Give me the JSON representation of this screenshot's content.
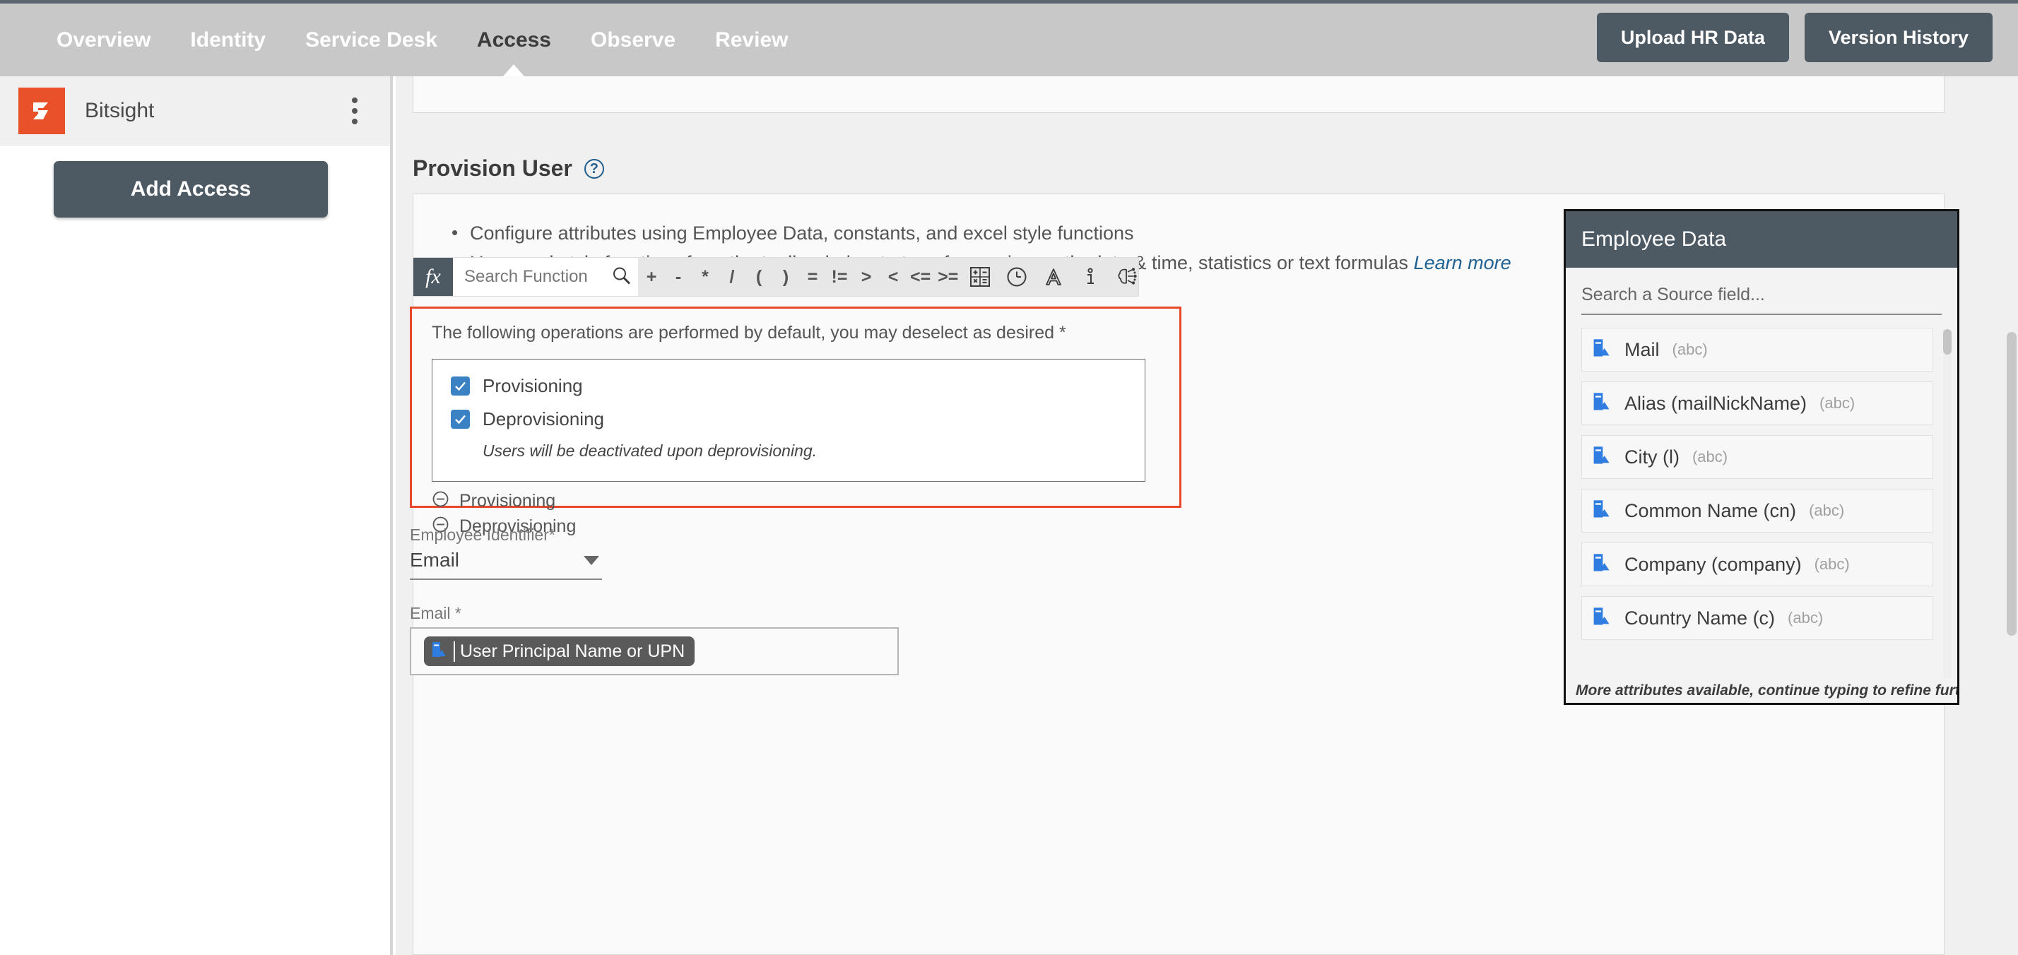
{
  "topnav": {
    "items": [
      {
        "label": "Overview",
        "active": false
      },
      {
        "label": "Identity",
        "active": false
      },
      {
        "label": "Service Desk",
        "active": false
      },
      {
        "label": "Access",
        "active": true
      },
      {
        "label": "Observe",
        "active": false
      },
      {
        "label": "Review",
        "active": false
      }
    ],
    "upload_button": "Upload HR Data",
    "version_button": "Version History",
    "bar_color": "#c8c8c8",
    "button_color": "#4e5a63"
  },
  "sidebar": {
    "app_name": "Bitsight",
    "logo_color": "#e8512a",
    "add_access_button": "Add Access"
  },
  "main": {
    "section_title": "Provision User",
    "bullets": [
      "Configure attributes using Employee Data, constants, and excel style functions",
      "Use excel-style functions from the toolbar below to transform using math, date & time, statistics or text formulas"
    ],
    "learn_more": "Learn more",
    "toolbar": {
      "fx_label": "fx",
      "search_placeholder": "Search Function",
      "search_value": "",
      "operators": [
        "+",
        "-",
        "*",
        "/",
        "(",
        ")",
        "=",
        "!=",
        ">",
        "<",
        "<=",
        ">="
      ],
      "icons": [
        "math-icon",
        "clock-icon",
        "text-icon",
        "info-icon",
        "ai-brain-icon"
      ]
    },
    "operations": {
      "caption": "The following operations are performed by default, you may deselect as desired *",
      "items": [
        {
          "label": "Provisioning",
          "checked": true
        },
        {
          "label": "Deprovisioning",
          "checked": true
        }
      ],
      "note": "Users will be deactivated upon deprovisioning.",
      "collapse_items": [
        "Provisioning",
        "Deprovisioning"
      ],
      "highlight_color": "#e8482a",
      "checkbox_color": "#3b82c4"
    },
    "form": {
      "identifier_label": "Employee Identifier*",
      "identifier_value": "Email",
      "email_label": "Email *",
      "email_token": "User Principal Name or UPN"
    }
  },
  "employee_data": {
    "title": "Employee Data",
    "search_placeholder": "Search a Source field...",
    "search_value": "",
    "items": [
      {
        "name": "Mail",
        "type": "(abc)"
      },
      {
        "name": "Alias (mailNickName)",
        "type": "(abc)"
      },
      {
        "name": "City (l)",
        "type": "(abc)"
      },
      {
        "name": "Common Name (cn)",
        "type": "(abc)"
      },
      {
        "name": "Company (company)",
        "type": "(abc)"
      },
      {
        "name": "Country Name (c)",
        "type": "(abc)"
      }
    ],
    "footer": "More attributes available, continue typing to refine further.",
    "header_color": "#4e5a63"
  }
}
